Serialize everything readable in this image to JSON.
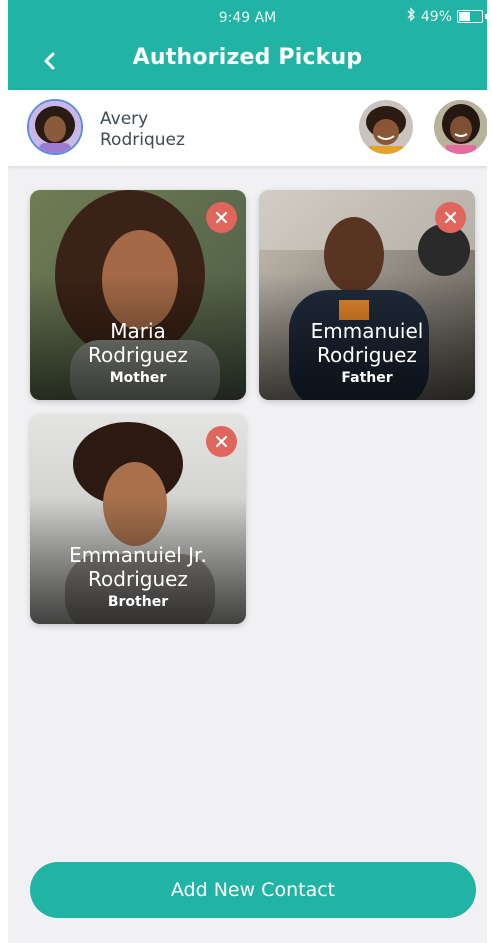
{
  "status_bar": {
    "time": "9:49 AM",
    "battery": "49%",
    "battery_level": 0.49
  },
  "header": {
    "title": "Authorized Pickup"
  },
  "child": {
    "first_name": "Avery",
    "last_name": "Rodriquez"
  },
  "contacts": [
    {
      "name_line1": "Maria",
      "name_line2": "Rodriguez",
      "relation": "Mother"
    },
    {
      "name_line1": "Emmanuiel",
      "name_line2": "Rodriguez",
      "relation": "Father"
    },
    {
      "name_line1": "Emmanuiel Jr.",
      "name_line2": "Rodriguez",
      "relation": "Brother"
    }
  ],
  "add_button": {
    "label": "Add New Contact"
  },
  "colors": {
    "accent": "#21b4a5",
    "remove": "#e0665d",
    "background": "#f1f1f3"
  },
  "icons": {
    "back": "chevron-left-icon",
    "bluetooth": "bluetooth-icon",
    "battery": "battery-icon",
    "remove": "close-icon"
  }
}
